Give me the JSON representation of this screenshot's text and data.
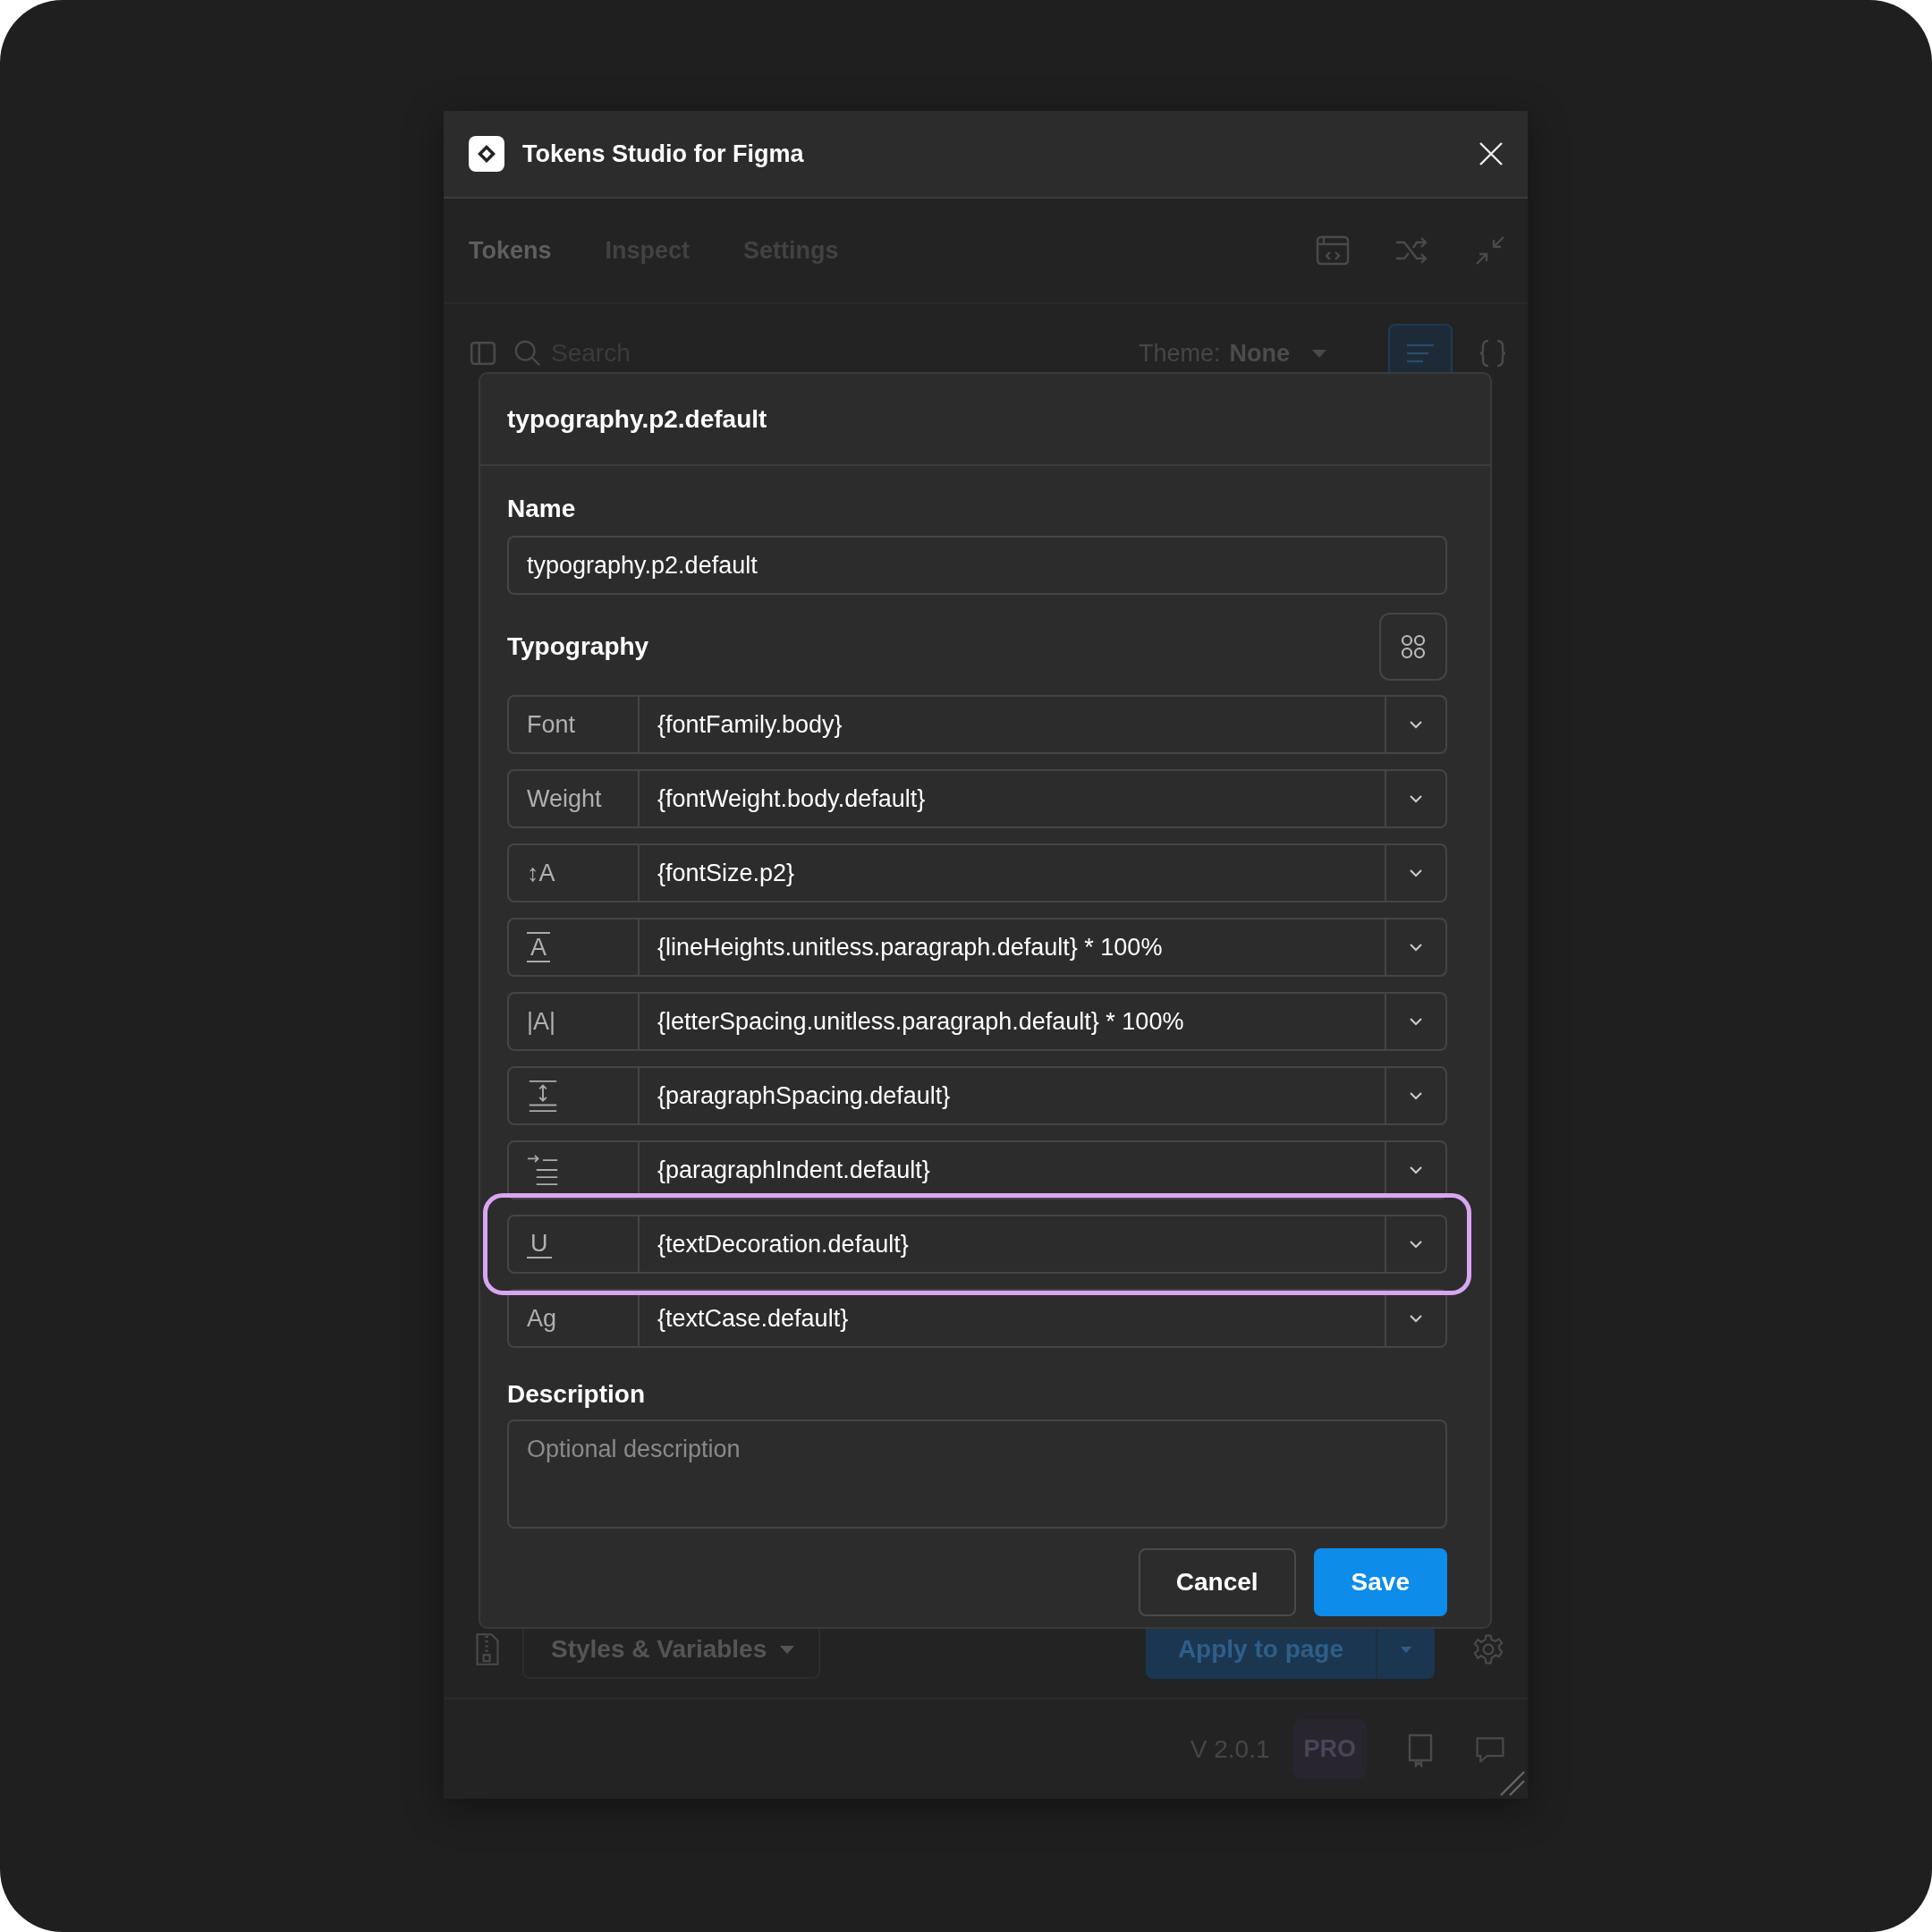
{
  "window": {
    "title": "Tokens Studio for Figma"
  },
  "tabs": [
    {
      "label": "Tokens",
      "selected": true
    },
    {
      "label": "Inspect",
      "selected": false
    },
    {
      "label": "Settings",
      "selected": false
    }
  ],
  "search": {
    "placeholder": "Search"
  },
  "theme": {
    "label": "Theme:",
    "value": "None"
  },
  "dialog": {
    "title": "typography.p2.default",
    "name_label": "Name",
    "name_value": "typography.p2.default",
    "typography_label": "Typography",
    "properties": [
      {
        "kind": "text",
        "label": "Font",
        "value": "{fontFamily.body}",
        "highlighted": false
      },
      {
        "kind": "text",
        "label": "Weight",
        "value": "{fontWeight.body.default}",
        "highlighted": false
      },
      {
        "kind": "text",
        "label": "↕A",
        "value": "{fontSize.p2}",
        "highlighted": false
      },
      {
        "kind": "ruled",
        "label": "A",
        "value": "{lineHeights.unitless.paragraph.default} * 100%",
        "highlighted": false
      },
      {
        "kind": "text",
        "label": "|A|",
        "value": "{letterSpacing.unitless.paragraph.default} * 100%",
        "highlighted": false
      },
      {
        "kind": "spacing",
        "value": "{paragraphSpacing.default}",
        "highlighted": false
      },
      {
        "kind": "indent",
        "value": "{paragraphIndent.default}",
        "highlighted": false
      },
      {
        "kind": "underlined",
        "label": "U",
        "value": "{textDecoration.default}",
        "highlighted": true
      },
      {
        "kind": "text",
        "label": "Ag",
        "value": "{textCase.default}",
        "highlighted": false
      }
    ],
    "description_label": "Description",
    "description_placeholder": "Optional description",
    "buttons": [
      {
        "label": "Cancel",
        "kind": "secondary"
      },
      {
        "label": "Save",
        "kind": "primary"
      }
    ]
  },
  "bottom_bar": {
    "styles_dropdown": "Styles & Variables",
    "apply_button": "Apply to page"
  },
  "footer": {
    "version": "V 2.0.1",
    "badge": "PRO"
  }
}
